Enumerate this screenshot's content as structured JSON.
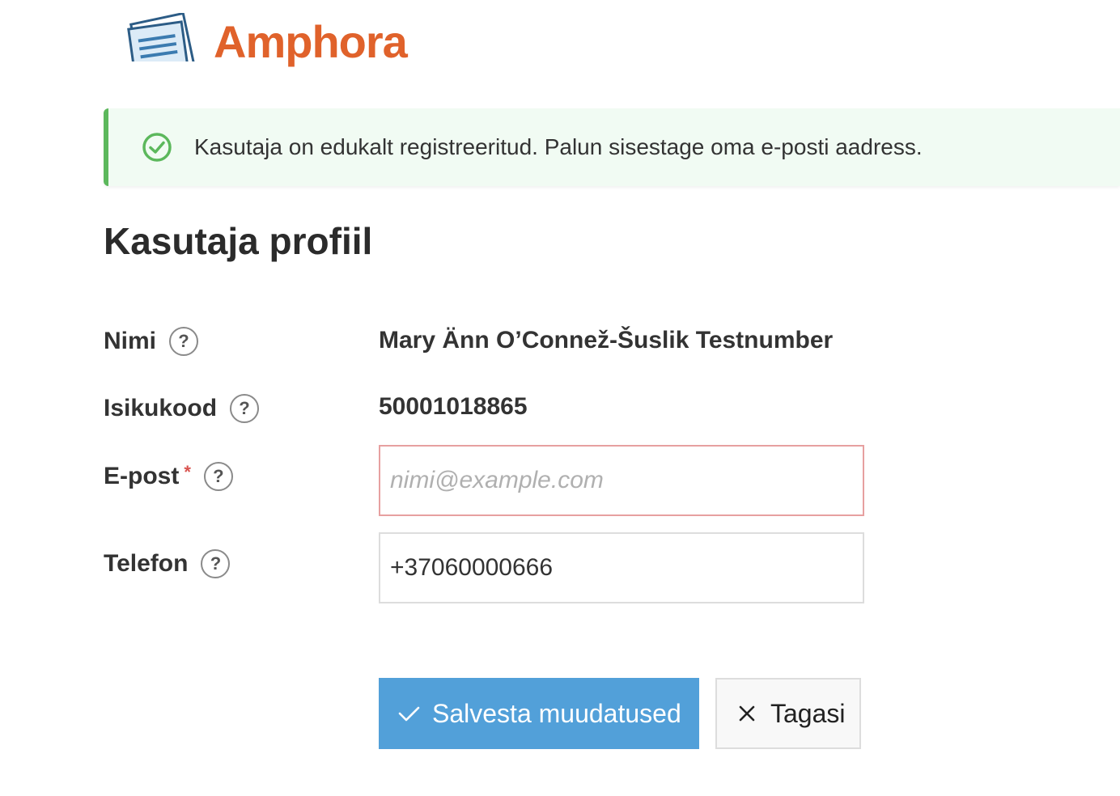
{
  "brand": {
    "name": "Amphora",
    "color": "#e0622b"
  },
  "alert": {
    "type": "success",
    "icon": "check-circle-icon",
    "message": "Kasutaja on edukalt registreeritud. Palun sisestage oma e-posti aadress.",
    "color": "#5cb85c"
  },
  "page": {
    "title": "Kasutaja profiil"
  },
  "form": {
    "name": {
      "label": "Nimi",
      "help": "?",
      "value": "Mary Änn O’Connež-Šuslik Testnumber"
    },
    "id_code": {
      "label": "Isikukood",
      "help": "?",
      "value": "50001018865"
    },
    "email": {
      "label": "E-post",
      "required_mark": "*",
      "help": "?",
      "value": "",
      "placeholder": "nimi@example.com"
    },
    "phone": {
      "label": "Telefon",
      "help": "?",
      "value": "+37060000666"
    }
  },
  "actions": {
    "save_label": "Salvesta muudatused",
    "save_icon": "check-icon",
    "save_color": "#52a0d9",
    "back_label": "Tagasi",
    "back_icon": "close-icon"
  }
}
